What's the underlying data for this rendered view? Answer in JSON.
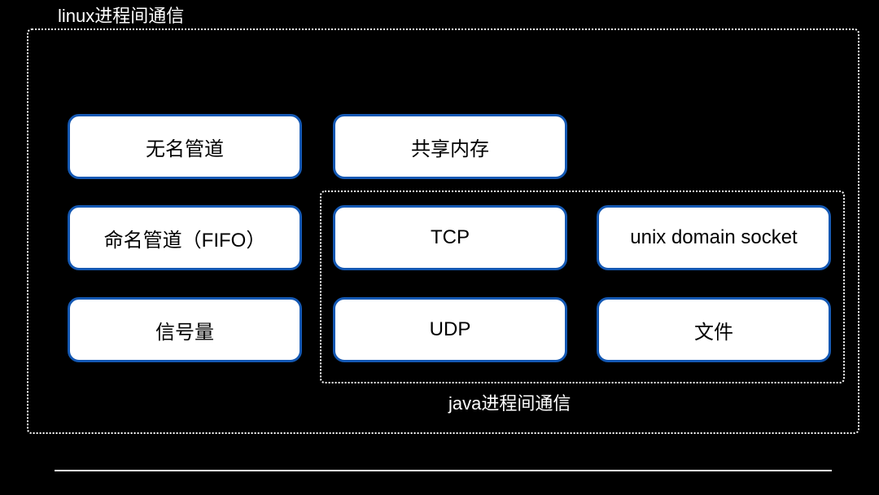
{
  "diagram": {
    "outer_container_label": "linux进程间通信",
    "inner_container_label": "java进程间通信",
    "boxes": {
      "anonymous_pipe": "无名管道",
      "shared_memory": "共享内存",
      "named_pipe": "命名管道（FIFO）",
      "tcp": "TCP",
      "unix_domain_socket": "unix domain socket",
      "semaphore": "信号量",
      "udp": "UDP",
      "file": "文件"
    }
  },
  "colors": {
    "background": "#000000",
    "box_fill": "#ffffff",
    "box_border": "#1458b3",
    "text_light": "#ffffff",
    "text_dark": "#000000"
  }
}
